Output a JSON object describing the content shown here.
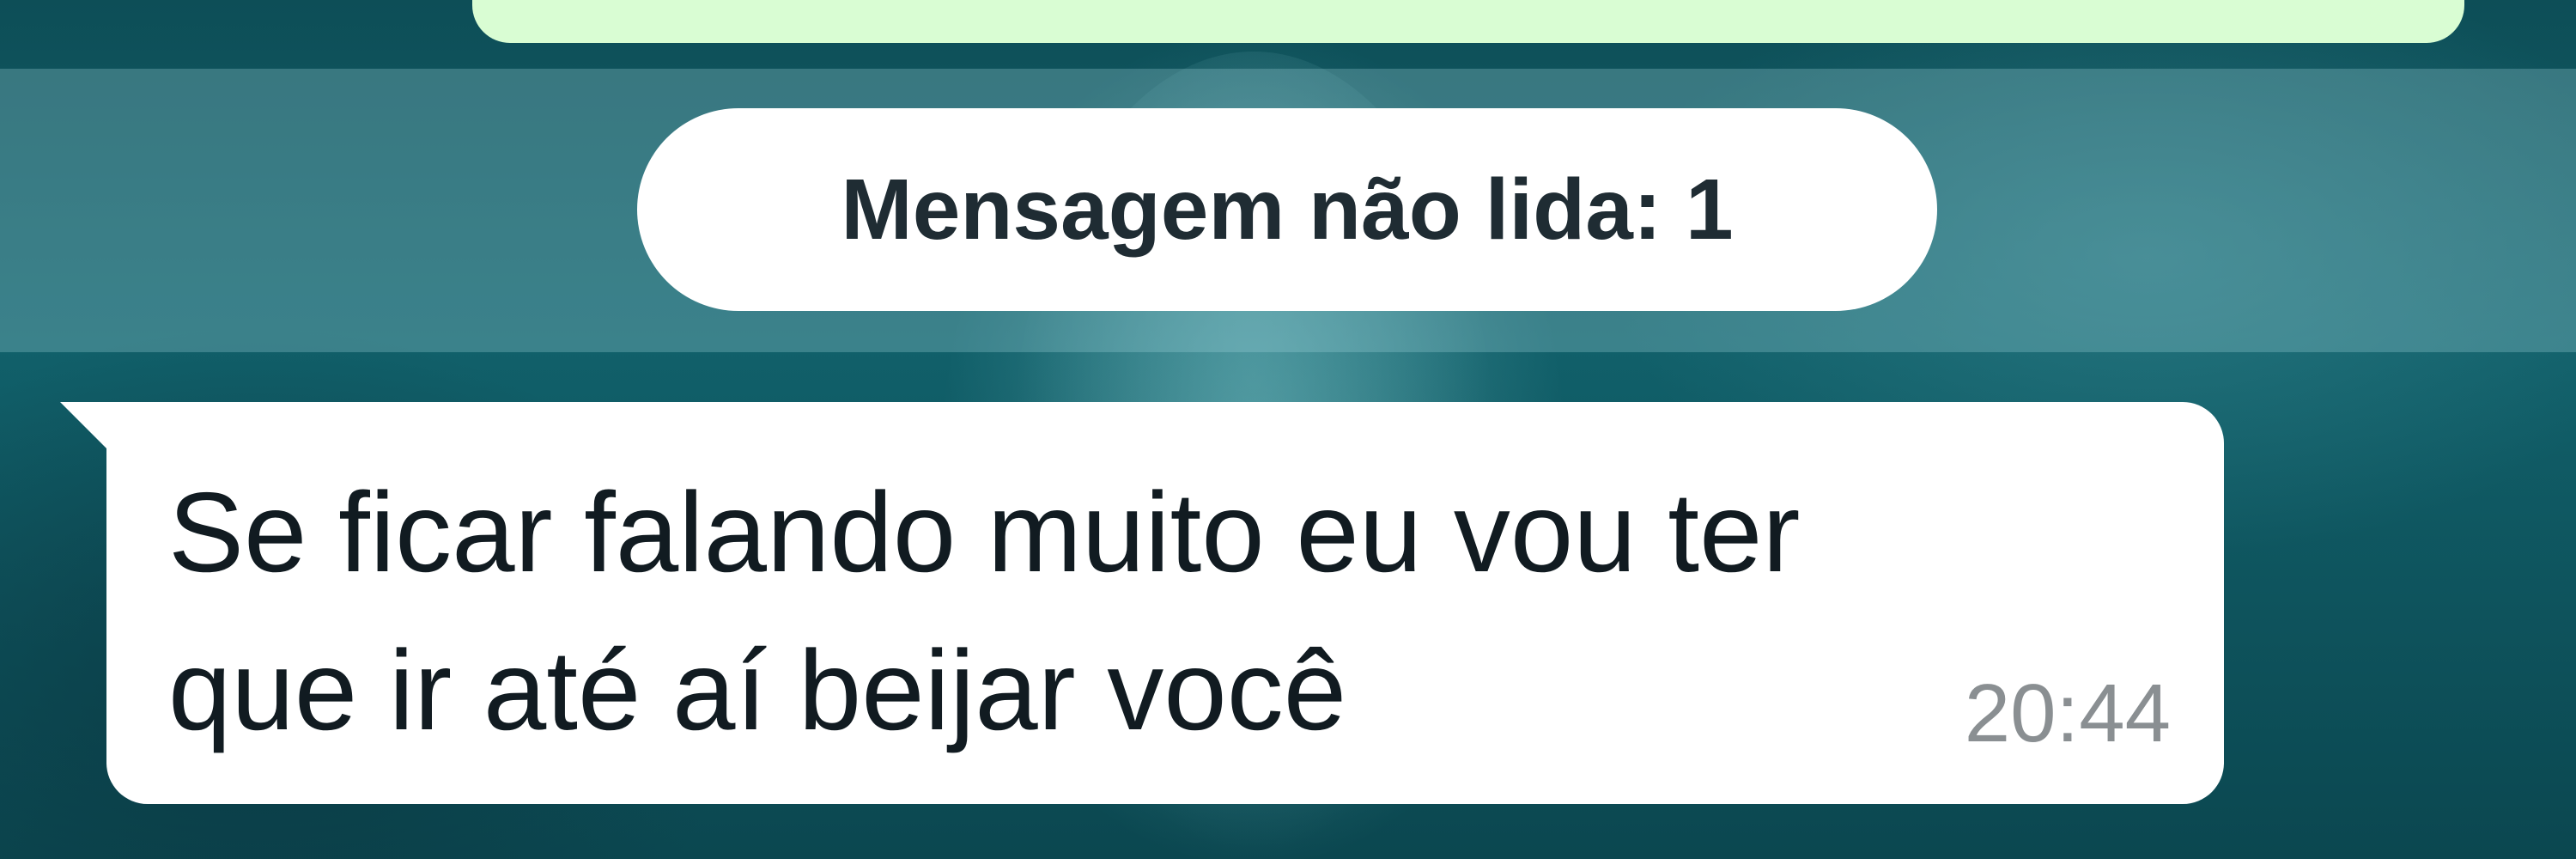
{
  "unread_banner": {
    "label": "Mensagem não lida: 1"
  },
  "messages": [
    {
      "direction": "incoming",
      "text": "Se ficar falando muito eu vou ter\nque ir até aí beijar você",
      "time": "20:44"
    }
  ],
  "colors": {
    "wallpaper": "#0c4a52",
    "incoming_bubble": "#ffffff",
    "outgoing_bubble": "#d9fdd3",
    "banner_background": "#ffffff",
    "message_text": "#111b21",
    "timestamp_text": "#8a8f92"
  }
}
